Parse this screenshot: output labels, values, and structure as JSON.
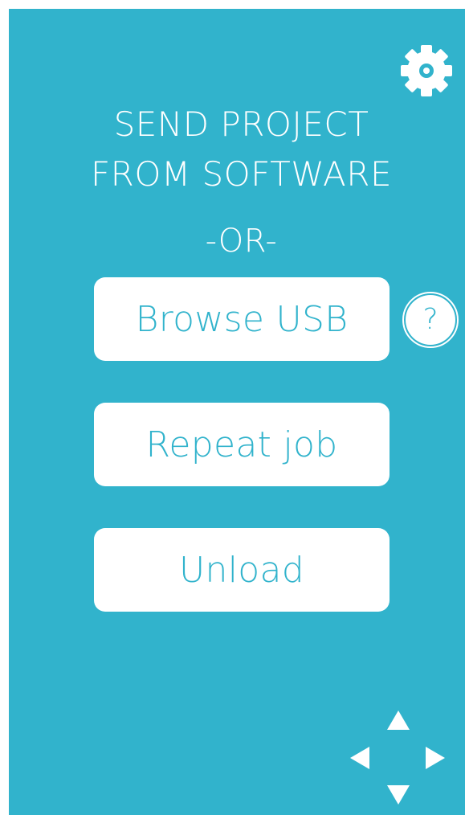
{
  "colors": {
    "background": "#31b3cc",
    "button_bg": "#ffffff",
    "button_text": "#31b3cc",
    "text": "#ffffff"
  },
  "header": {
    "settings_icon": "gear-icon",
    "line1": "SEND PROJECT",
    "line2": "FROM SOFTWARE",
    "separator": "-OR-"
  },
  "buttons": {
    "browse_usb": "Browse USB",
    "repeat_job": "Repeat job",
    "unload": "Unload"
  },
  "help": {
    "label": "?",
    "icon": "help-icon"
  },
  "dpad": {
    "up_icon": "arrow-up-icon",
    "down_icon": "arrow-down-icon",
    "left_icon": "arrow-left-icon",
    "right_icon": "arrow-right-icon"
  }
}
